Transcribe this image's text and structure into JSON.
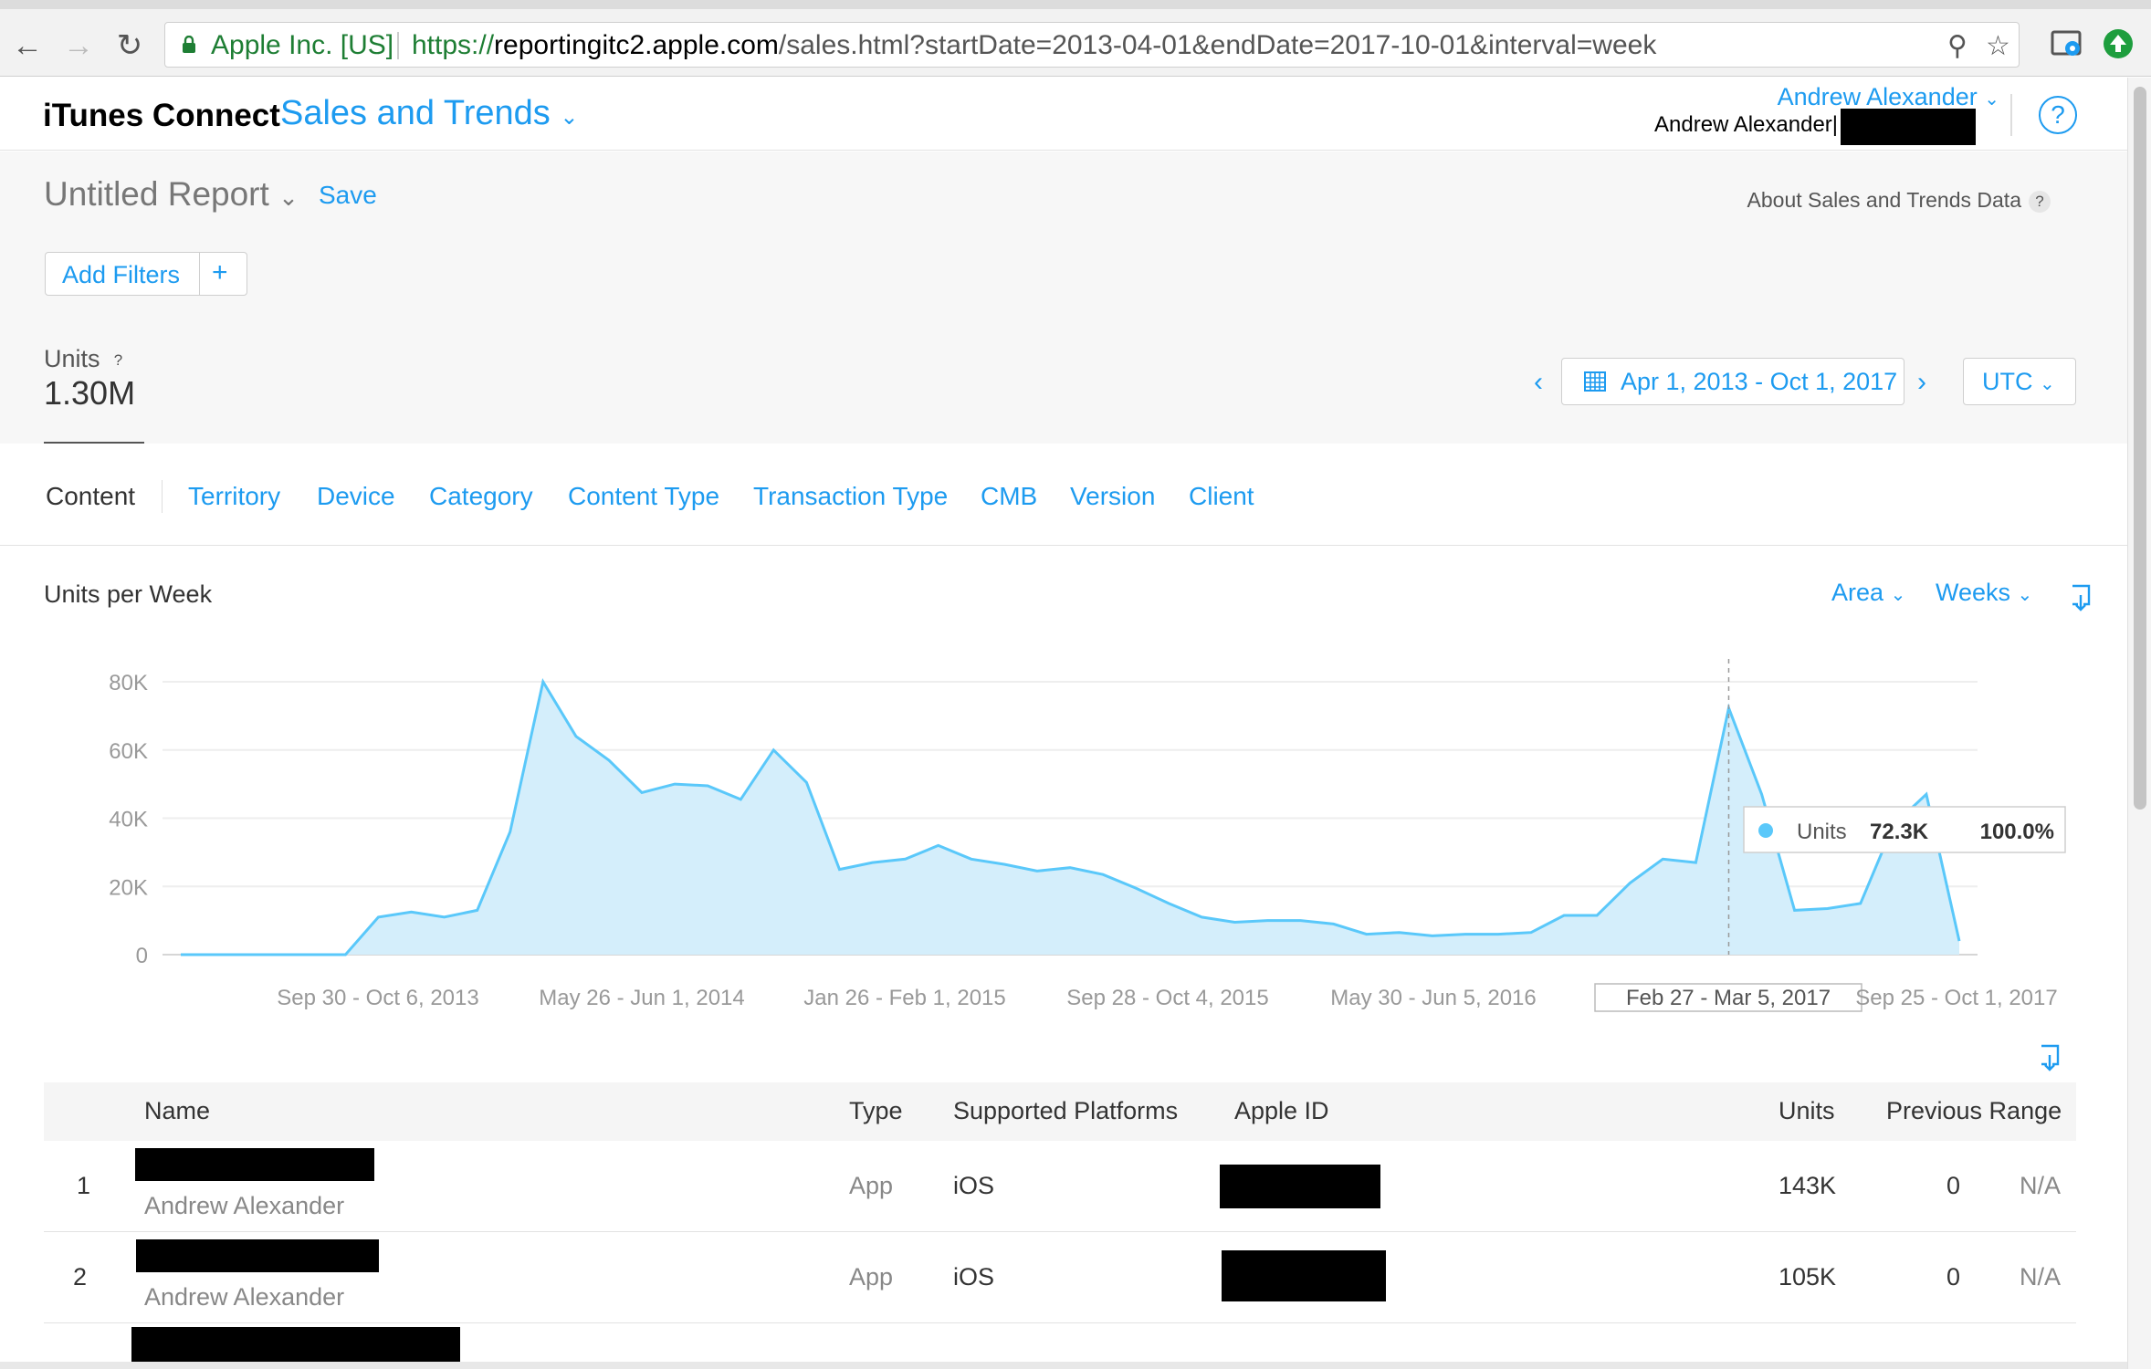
{
  "browser": {
    "secure_label": "Apple Inc. [US]",
    "url_proto": "https://",
    "url_host": "reportingitc2.apple.com",
    "url_path": "/sales.html?startDate=2013-04-01&endDate=2017-10-01&interval=week",
    "icons": [
      "back-arrow-icon",
      "forward-arrow-icon",
      "reload-icon",
      "lock-icon",
      "zoom-icon",
      "bookmark-star-icon",
      "cast-icon",
      "update-icon"
    ]
  },
  "header": {
    "brand": "iTunes Connect",
    "module": "Sales and Trends",
    "user": "Andrew Alexander",
    "user_sub": "Andrew Alexander|",
    "help": "?"
  },
  "report": {
    "title": "Untitled Report",
    "save": "Save",
    "about": "About Sales and Trends Data",
    "about_help": "?",
    "add_filters": "Add Filters",
    "add_plus": "+",
    "metric_label": "Units",
    "metric_help": "?",
    "metric_value": "1.30M",
    "date_range": "Apr 1, 2013 - Oct 1, 2017",
    "timezone": "UTC"
  },
  "tabs": [
    {
      "label": "Content",
      "active": true
    },
    {
      "label": "Territory",
      "active": false
    },
    {
      "label": "Device",
      "active": false
    },
    {
      "label": "Category",
      "active": false
    },
    {
      "label": "Content Type",
      "active": false
    },
    {
      "label": "Transaction Type",
      "active": false
    },
    {
      "label": "CMB",
      "active": false
    },
    {
      "label": "Version",
      "active": false
    },
    {
      "label": "Client",
      "active": false
    }
  ],
  "chart_controls": {
    "title": "Units per Week",
    "chart_type": "Area",
    "interval": "Weeks"
  },
  "chart_data": {
    "type": "area",
    "title": "Units per Week",
    "y_ticks": [
      "80K",
      "60K",
      "40K",
      "20K",
      "0"
    ],
    "x_tick_labels": [
      "Sep 30 - Oct 6, 2013",
      "May 26 - Jun 1, 2014",
      "Jan 26 - Feb 1, 2015",
      "Sep 28 - Oct 4, 2015",
      "May 30 - Jun 5, 2016",
      "Feb 27 - Mar 5, 2017",
      "Sep 25 - Oct 1, 2017"
    ],
    "highlighted_tick": "Feb 27 - Mar 5, 2017",
    "ylim": [
      0,
      80000
    ],
    "grid": true,
    "color": "#5ac8fa",
    "fill": "#d4eefb",
    "series": [
      {
        "name": "Units",
        "values": [
          0,
          0,
          0,
          0,
          0,
          0,
          11000,
          12500,
          11000,
          13000,
          36000,
          80000,
          64000,
          57000,
          47500,
          50000,
          49500,
          45500,
          60000,
          50500,
          25000,
          27000,
          28000,
          32000,
          28000,
          26500,
          24500,
          25500,
          23500,
          19500,
          15000,
          11000,
          9500,
          10000,
          10000,
          9000,
          6000,
          6500,
          5500,
          6000,
          6000,
          6500,
          11500,
          11500,
          21000,
          28000,
          27000,
          72300,
          47000,
          13000,
          13500,
          15000,
          38000,
          47000,
          4000
        ]
      }
    ],
    "tooltip": {
      "label": "Units",
      "value": "72.3K",
      "percent": "100.0%"
    }
  },
  "table": {
    "columns": [
      "Name",
      "Type",
      "Supported Platforms",
      "Apple ID",
      "Units",
      "Previous Range"
    ],
    "rows": [
      {
        "rank": "1",
        "developer": "Andrew Alexander",
        "type": "App",
        "platform": "iOS",
        "units": "143K",
        "previous": "0",
        "change": "N/A"
      },
      {
        "rank": "2",
        "developer": "Andrew Alexander",
        "type": "App",
        "platform": "iOS",
        "units": "105K",
        "previous": "0",
        "change": "N/A"
      }
    ]
  }
}
